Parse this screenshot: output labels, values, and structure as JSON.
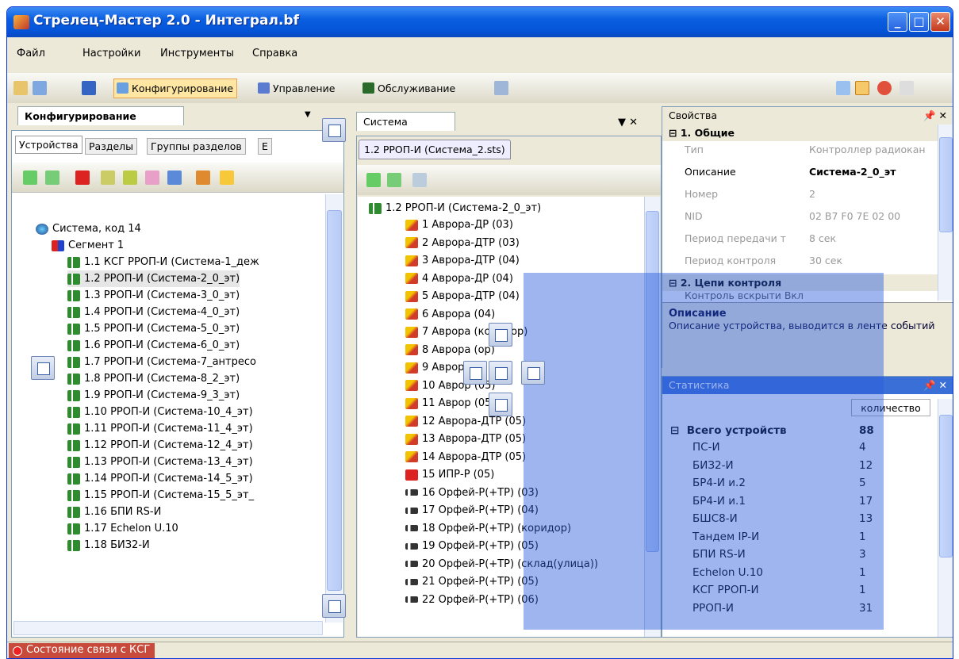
{
  "window": {
    "title": "Стрелец-Мастер 2.0 - Интеграл.bf"
  },
  "menu": [
    "Файл",
    "Настройки",
    "Инструменты",
    "Справка"
  ],
  "toolbar": {
    "config": "Конфигурирование",
    "control": "Управление",
    "service": "Обслуживание"
  },
  "left_panel": {
    "title": "Конфигурирование",
    "tabs": [
      "Устройства",
      "Разделы",
      "Группы разделов",
      "Е"
    ],
    "root": "Система, код 14",
    "segment": "Сегмент 1",
    "items": [
      "1.1 КСГ РРОП-И (Система-1_деж",
      "1.2 РРОП-И (Система-2_0_эт)",
      "1.3 РРОП-И (Система-3_0_эт)",
      "1.4 РРОП-И (Система-4_0_эт)",
      "1.5 РРОП-И (Система-5_0_эт)",
      "1.6 РРОП-И (Система-6_0_эт)",
      "1.7 РРОП-И (Система-7_антресо",
      "1.8 РРОП-И (Система-8_2_эт)",
      "1.9 РРОП-И (Система-9_3_эт)",
      "1.10 РРОП-И (Система-10_4_эт)",
      "1.11 РРОП-И (Система-11_4_эт)",
      "1.12 РРОП-И (Система-12_4_эт)",
      "1.13 РРОП-И (Система-13_4_эт)",
      "1.14 РРОП-И (Система-14_5_эт)",
      "1.15 РРОП-И (Система-15_5_эт_",
      "1.16 БПИ RS-И",
      "1.17 Echelon U.10",
      "1.18 БИЗ2-И"
    ]
  },
  "mid_panel": {
    "title": "Система",
    "doc_tab": "1.2 РРОП-И (Система_2.sts)",
    "root": "1.2 РРОП-И (Система-2_0_эт)",
    "items": [
      "1 Аврора-ДР (03)",
      "2 Аврора-ДТР (03)",
      "3 Аврора-ДТР (04)",
      "4 Аврора-ДР (04)",
      "5 Аврора-ДТР (04)",
      "6 Аврора (04)",
      "7 Аврора (коридор)",
      "8 Аврора (ор)",
      "9 Аврора",
      "10 Аврор (05)",
      "11 Аврор (05)",
      "12 Аврора-ДТР (05)",
      "13 Аврора-ДТР (05)",
      "14 Аврора-ДТР (05)",
      "15 ИПР-Р (05)",
      "16 Орфей-Р(+ТР) (03)",
      "17 Орфей-Р(+ТР) (04)",
      "18 Орфей-Р(+ТР) (коридор)",
      "19 Орфей-Р(+ТР) (05)",
      "20 Орфей-Р(+ТР) (склад(улица))",
      "21 Орфей-Р(+ТР) (05)",
      "22 Орфей-Р(+ТР) (06)"
    ]
  },
  "properties": {
    "title": "Свойства",
    "group1": "1. Общие",
    "rows": [
      {
        "k": "Тип",
        "v": "Контроллер радиокан"
      },
      {
        "k": "Описание",
        "v": "Система-2_0_эт"
      },
      {
        "k": "Номер",
        "v": "2"
      },
      {
        "k": "NID",
        "v": "02 B7 F0 7E 02 00"
      },
      {
        "k": "Период передачи т",
        "v": "8 сек"
      },
      {
        "k": "Период контроля",
        "v": "30 сек"
      }
    ],
    "group2": "2. Цепи контроля",
    "row_partial": "Контроль вскрыти Вкл",
    "desc_title": "Описание",
    "desc_text": "Описание устройства, выводится в ленте событий"
  },
  "stats": {
    "title": "Статистика",
    "col": "количество",
    "total_label": "Всего устройств",
    "total": "88",
    "rows": [
      {
        "k": "ПС-И",
        "v": "4"
      },
      {
        "k": "БИЗ2-И",
        "v": "12"
      },
      {
        "k": "БР4-И и.2",
        "v": "5"
      },
      {
        "k": "БР4-И и.1",
        "v": "17"
      },
      {
        "k": "БШС8-И",
        "v": "13"
      },
      {
        "k": "Тандем IP-И",
        "v": "1"
      },
      {
        "k": "БПИ RS-И",
        "v": "3"
      },
      {
        "k": "Echelon U.10",
        "v": "1"
      },
      {
        "k": "КСГ РРОП-И",
        "v": "1"
      },
      {
        "k": "РРОП-И",
        "v": "31"
      }
    ]
  },
  "status": {
    "text": "Состояние связи с КСГ"
  }
}
